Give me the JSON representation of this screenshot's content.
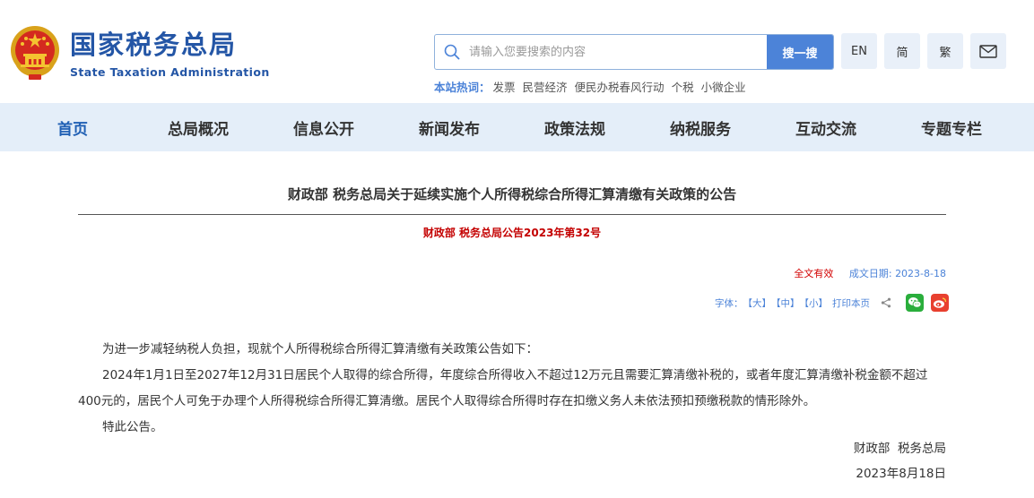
{
  "site": {
    "name_cn": "国家税务总局",
    "name_en": "State Taxation Administration"
  },
  "search": {
    "placeholder": "请输入您要搜索的内容",
    "button_label": "搜一搜"
  },
  "languages": [
    "EN",
    "简",
    "繁"
  ],
  "hot": {
    "label": "本站热词：",
    "items": [
      "发票",
      "民营经济",
      "便民办税春风行动",
      "个税",
      "小微企业"
    ]
  },
  "nav": {
    "items": [
      "首页",
      "总局概况",
      "信息公开",
      "新闻发布",
      "政策法规",
      "纳税服务",
      "互动交流",
      "专题专栏"
    ]
  },
  "article": {
    "title": "财政部 税务总局关于延续实施个人所得税综合所得汇算清缴有关政策的公告",
    "doc_number": "财政部 税务总局公告2023年第32号",
    "validity": "全文有效",
    "date_label": "成文日期:",
    "date": "2023-8-18",
    "font_label": "字体：",
    "font_large": "【大】",
    "font_medium": "【中】",
    "font_small": "【小】",
    "print_label": "打印本页",
    "paragraphs": [
      "为进一步减轻纳税人负担，现就个人所得税综合所得汇算清缴有关政策公告如下：",
      "2024年1月1日至2027年12月31日居民个人取得的综合所得，年度综合所得收入不超过12万元且需要汇算清缴补税的，或者年度汇算清缴补税金额不超过400元的，居民个人可免于办理个人所得税综合所得汇算清缴。居民个人取得综合所得时存在扣缴义务人未依法预扣预缴税款的情形除外。",
      "特此公告。"
    ],
    "signatory": "财政部  税务总局",
    "sign_date": "2023年8月18日"
  },
  "colors": {
    "brand_blue": "#2456a6",
    "accent_blue": "#4c83d8",
    "nav_bg": "#e4eef9",
    "doc_red": "#c40000"
  }
}
